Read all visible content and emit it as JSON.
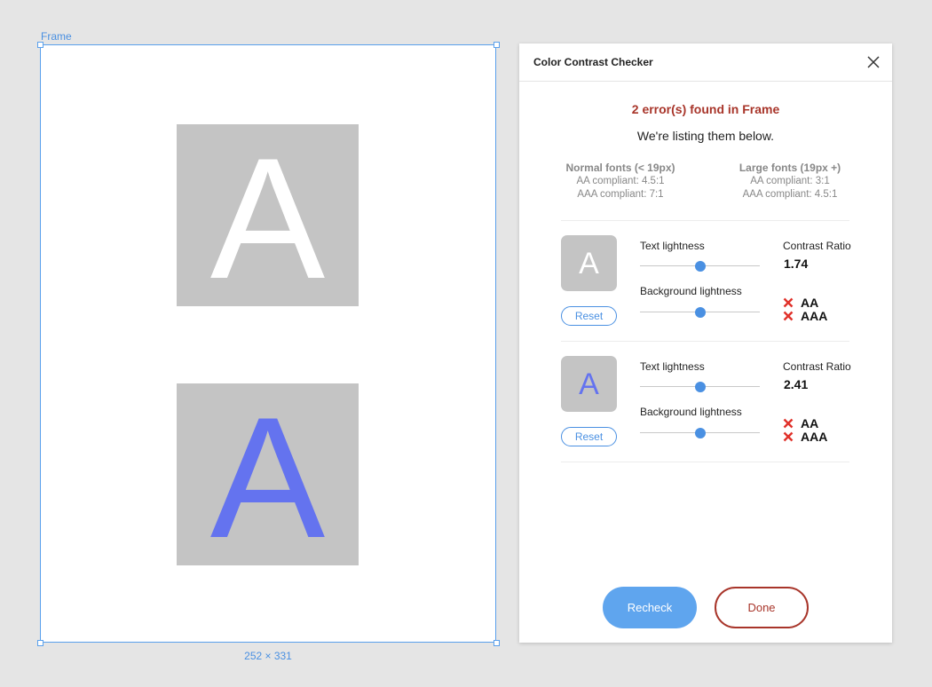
{
  "canvas": {
    "frame_label": "Frame",
    "frame_size": "252 × 331",
    "samples": [
      {
        "letter": "A",
        "text_color": "#ffffff",
        "background": "#c4c4c4"
      },
      {
        "letter": "A",
        "text_color": "#6473ef",
        "background": "#c4c4c4"
      }
    ]
  },
  "panel": {
    "title": "Color Contrast Checker",
    "summary": {
      "error_text": "2 error(s) found in Frame",
      "subtitle": "We're listing them below."
    },
    "legend": {
      "normal": {
        "title": "Normal fonts (< 19px)",
        "aa": "AA compliant: 4.5:1",
        "aaa": "AAA compliant: 7:1"
      },
      "large": {
        "title": "Large fonts (19px +)",
        "aa": "AA compliant: 3:1",
        "aaa": "AAA compliant: 4.5:1"
      }
    },
    "results": [
      {
        "preview_letter": "A",
        "text_color": "#ffffff",
        "reset_label": "Reset",
        "text_lightness_label": "Text lightness",
        "text_lightness": 0.5,
        "bg_lightness_label": "Background lightness",
        "bg_lightness": 0.5,
        "ratio_label": "Contrast Ratio",
        "ratio_value": "1.74",
        "aa_label": "AA",
        "aa_pass": false,
        "aaa_label": "AAA",
        "aaa_pass": false
      },
      {
        "preview_letter": "A",
        "text_color": "#6473ef",
        "reset_label": "Reset",
        "text_lightness_label": "Text lightness",
        "text_lightness": 0.5,
        "bg_lightness_label": "Background lightness",
        "bg_lightness": 0.5,
        "ratio_label": "Contrast Ratio",
        "ratio_value": "2.41",
        "aa_label": "AA",
        "aa_pass": false,
        "aaa_label": "AAA",
        "aaa_pass": false
      }
    ],
    "buttons": {
      "recheck": "Recheck",
      "done": "Done"
    },
    "colors": {
      "accent": "#4a90e2",
      "error": "#a8352a",
      "fail_icon": "#e0312a"
    }
  }
}
